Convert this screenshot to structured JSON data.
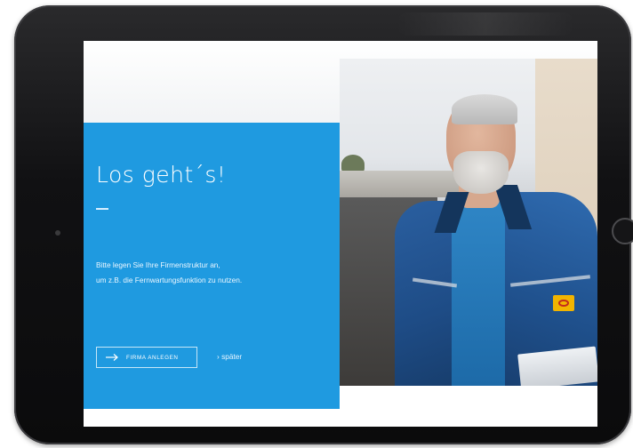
{
  "onboarding": {
    "title": "Los geht´s!",
    "intro_line_1": "Bitte legen Sie Ihre Firmenstruktur an,",
    "intro_line_2": "um z.B. die Fernwartungsfunktion zu nutzen.",
    "primary_button_label": "FIRMA ANLEGEN",
    "secondary_link_label": "› später"
  },
  "colors": {
    "panel_blue": "#1f9ae0",
    "device_bezel": "#111113",
    "text_on_blue": "#ffffff"
  },
  "icons": {
    "cta_icon": "arrow-right-icon",
    "device_button": "home-button-icon"
  }
}
